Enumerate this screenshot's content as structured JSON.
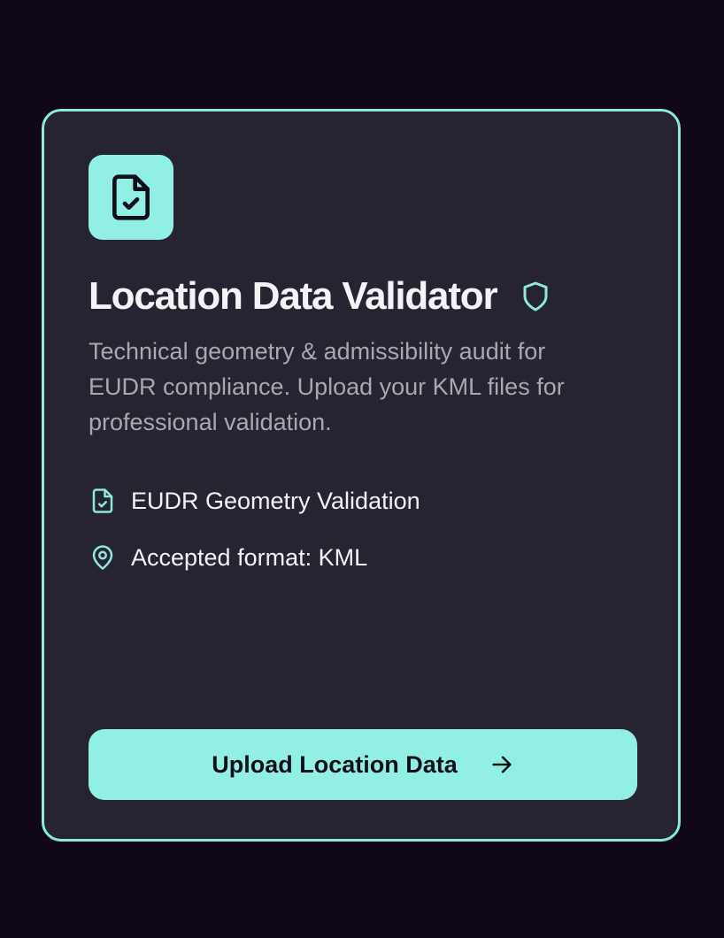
{
  "card": {
    "title": "Location Data Validator",
    "description": "Technical geometry & admissibility audit for EUDR compliance. Upload your KML files for professional validation.",
    "header_icon": "file-check-icon",
    "title_badge_icon": "shield-icon",
    "features": [
      {
        "icon": "file-check-icon",
        "label": "EUDR Geometry Validation"
      },
      {
        "icon": "map-pin-icon",
        "label": "Accepted format: KML"
      }
    ],
    "cta": {
      "label": "Upload Location Data",
      "icon": "arrow-right-icon"
    }
  },
  "colors": {
    "page_background": "#100818",
    "card_background": "#262431",
    "accent": "#91efe6",
    "title_text": "#f4f3f6",
    "body_text": "#a9a8b1"
  }
}
